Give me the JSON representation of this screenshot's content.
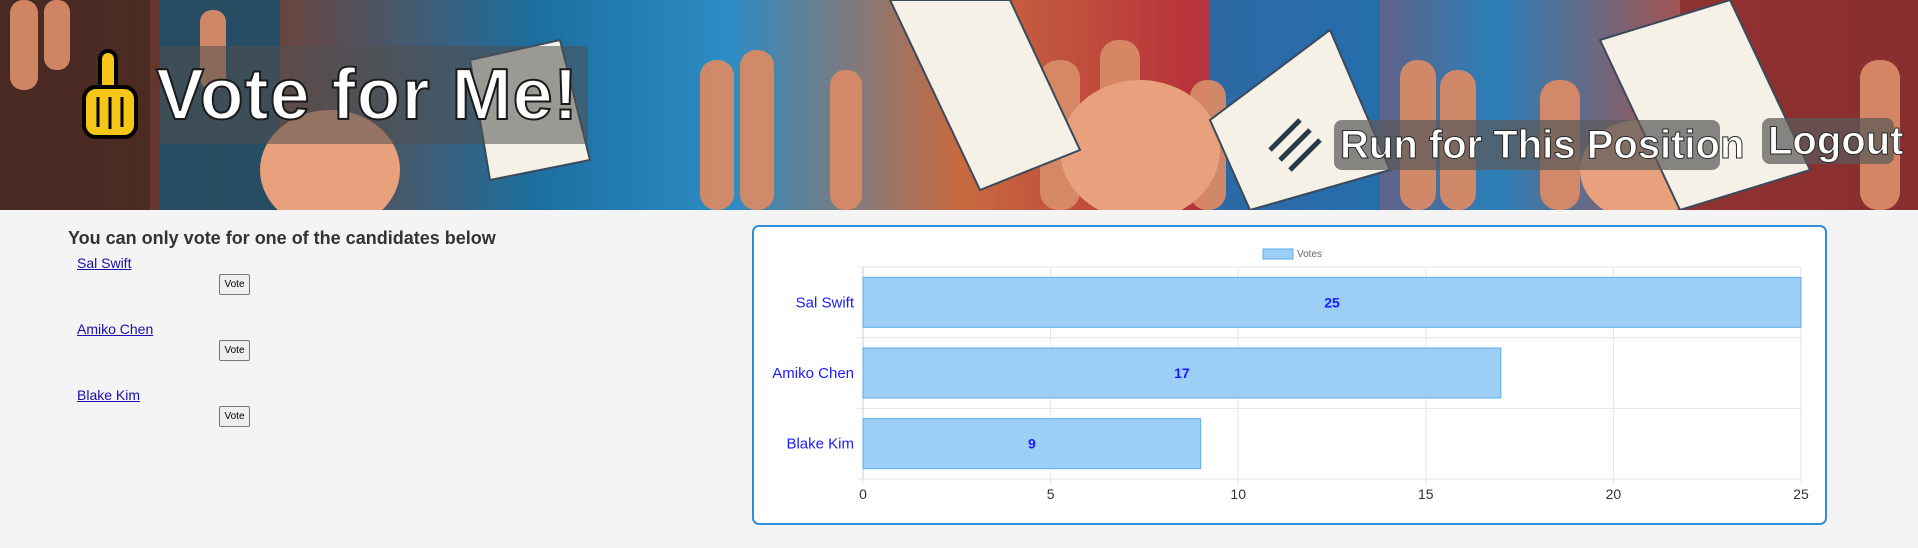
{
  "header": {
    "title": "Vote for Me!",
    "nav": {
      "run_label": "Run for This Position",
      "logout_label": "Logout"
    }
  },
  "voting": {
    "instruction": "You can only vote for one of the candidates below",
    "vote_label": "Vote",
    "candidates": [
      {
        "name": "Sal Swift"
      },
      {
        "name": "Amiko Chen"
      },
      {
        "name": "Blake Kim"
      }
    ]
  },
  "chart_data": {
    "type": "bar",
    "orientation": "horizontal",
    "categories": [
      "Sal Swift",
      "Amiko Chen",
      "Blake Kim"
    ],
    "series": [
      {
        "name": "Votes",
        "values": [
          25,
          17,
          9
        ]
      }
    ],
    "xlim": [
      0,
      25
    ],
    "xticks": [
      0,
      5,
      10,
      15,
      20,
      25
    ],
    "grid": true,
    "legend": "top",
    "colors": {
      "bar_fill": "#9dcef5",
      "bar_stroke": "#5eaee8",
      "label": "#1a1aff",
      "grid": "#e6e6e6",
      "card_border": "#2f8fd8"
    }
  }
}
